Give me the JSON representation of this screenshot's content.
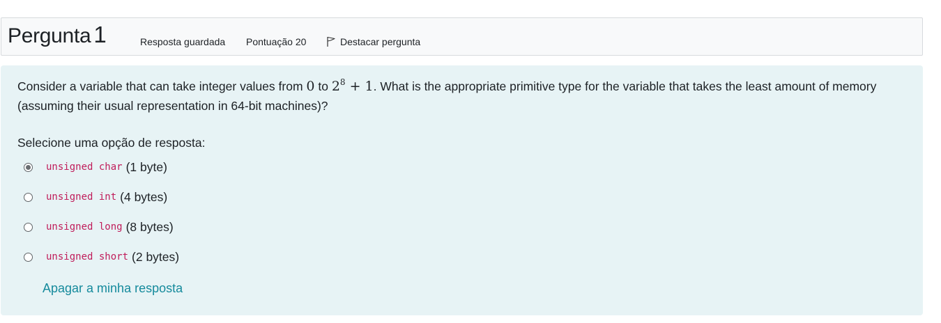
{
  "info": {
    "question_label": "Pergunta",
    "question_number": "1",
    "state": "Resposta guardada",
    "grade": "Pontuação 20",
    "flag_label": "Destacar pergunta",
    "flag_icon": "flag-outline-icon"
  },
  "question": {
    "text_before": "Consider a variable that can take integer values from ",
    "math_zero": "0",
    "text_to": " to ",
    "math_base": "2",
    "math_exp": "8",
    "math_plus": " + 1",
    "text_after": ". What is the appropriate primitive type for the variable that takes the least amount of memory (assuming their usual representation in 64-bit machines)?"
  },
  "prompt": "Selecione uma opção de resposta:",
  "answers": [
    {
      "code": "unsigned char",
      "size": "(1 byte)",
      "selected": true
    },
    {
      "code": "unsigned int",
      "size": "(4 bytes)",
      "selected": false
    },
    {
      "code": "unsigned long",
      "size": "(8 bytes)",
      "selected": false
    },
    {
      "code": "unsigned short",
      "size": "(2 bytes)",
      "selected": false
    }
  ],
  "clear_choice": "Apagar a minha resposta",
  "colors": {
    "info_bg": "#f8f9fa",
    "content_bg": "#e7f3f5",
    "code": "#c01c5a",
    "link": "#158a9c"
  }
}
